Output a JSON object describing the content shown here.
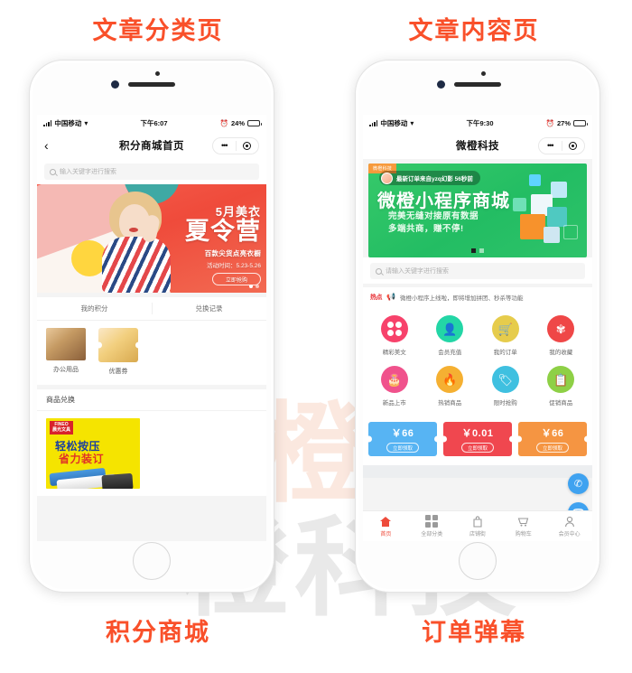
{
  "captions": {
    "top_left": "文章分类页",
    "top_right": "文章内容页",
    "bottom_left": "积分商城",
    "bottom_right": "订单弹幕"
  },
  "watermark": {
    "line1": "微橙",
    "line2": "橙科技"
  },
  "colors": {
    "caption": "#f9502a",
    "left_banner": "#ef4b3b",
    "right_banner": "#23bd63",
    "tab_active": "#ee4b3b",
    "float_button": "#3fa2f0"
  },
  "left_phone": {
    "status": {
      "carrier": "中国移动",
      "wifi_icon": "wifi-icon",
      "time": "下午6:07",
      "alarm_icon": "alarm-icon",
      "battery_pct": "24%"
    },
    "nav": {
      "back_icon": "chevron-left-icon",
      "title": "积分商城首页",
      "dots_icon": "more-dots-icon",
      "target_icon": "target-icon"
    },
    "search": {
      "placeholder": "输入关键字进行搜索",
      "icon": "search-icon"
    },
    "banner": {
      "line1": "5月美衣",
      "line2": "夏令营",
      "line3": "百款尖货点亮衣橱",
      "line4": "活动时间：5.23-5.26",
      "button": "立即抢购"
    },
    "tabs": [
      "我的积分",
      "兑换记录"
    ],
    "categories": [
      {
        "label": "办公用品",
        "image": "office-supplies-thumb"
      },
      {
        "label": "优惠券",
        "image": "coupon-thumb"
      }
    ],
    "section": {
      "title": "商品兑换"
    },
    "product": {
      "brand": "FINEO\n晨光文具",
      "title_line1": "轻松按压",
      "title_line2": "省力装订",
      "image": "stapler-photo"
    }
  },
  "right_phone": {
    "status": {
      "carrier": "中国移动",
      "wifi_icon": "wifi-icon",
      "time": "下午9:30",
      "alarm_icon": "alarm-icon",
      "battery_pct": "27%"
    },
    "nav": {
      "title": "微橙科技",
      "dots_icon": "more-dots-icon",
      "target_icon": "target-icon"
    },
    "banner": {
      "tag": "微橙科技",
      "danmu": "最新订单来自yzq幻影 56秒前",
      "title": "微橙小程序商城",
      "sub_line1": "完美无缝对接原有数据",
      "sub_line2": "多端共商，赚不停!"
    },
    "search": {
      "placeholder": "请输入关键字进行搜索",
      "icon": "search-icon"
    },
    "hot": {
      "badge": "热点",
      "horn_icon": "megaphone-icon",
      "text": "微橙小程序上线啦，即将增加拼团、秒杀等功能"
    },
    "grid": [
      {
        "label": "精彩美文",
        "color": "#f7426b",
        "icon": "four-circles-icon"
      },
      {
        "label": "会员充值",
        "color": "#23d6a6",
        "icon": "member-icon"
      },
      {
        "label": "我的订单",
        "color": "#e6cc4c",
        "icon": "cart-icon"
      },
      {
        "label": "我的收藏",
        "color": "#ef4747",
        "icon": "star-person-icon"
      },
      {
        "label": "新品上市",
        "color": "#f0528c",
        "icon": "cake-icon"
      },
      {
        "label": "热销商品",
        "color": "#f5b032",
        "icon": "hot-flame-icon"
      },
      {
        "label": "限时抢购",
        "color": "#3fc0e0",
        "icon": "tag-icon"
      },
      {
        "label": "促销商品",
        "color": "#8ed046",
        "icon": "clipboard-icon"
      }
    ],
    "coupons": [
      {
        "amount": "￥66",
        "button": "立即领取",
        "color": "#57b4f3"
      },
      {
        "amount": "￥0.01",
        "button": "立即领取",
        "color": "#f0474f"
      },
      {
        "amount": "￥66",
        "button": "立即领取",
        "color": "#f59542"
      }
    ],
    "float_buttons": [
      {
        "icon": "phone-icon",
        "glyph": "✆"
      },
      {
        "icon": "headset-icon",
        "glyph": "🎧"
      }
    ],
    "tabbar": [
      {
        "label": "首页",
        "icon": "home-icon",
        "active": true
      },
      {
        "label": "全部分类",
        "icon": "grid-icon",
        "active": false
      },
      {
        "label": "店铺街",
        "icon": "shop-bag-icon",
        "active": false
      },
      {
        "label": "购物车",
        "icon": "cart-icon",
        "active": false
      },
      {
        "label": "会员中心",
        "icon": "user-icon",
        "active": false
      }
    ]
  }
}
